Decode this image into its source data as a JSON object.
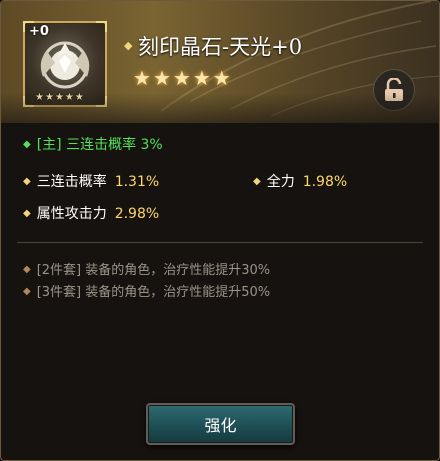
{
  "item": {
    "plus_level": "+0",
    "name": "刻印晶石-天光+0",
    "stars": 5
  },
  "main_stat": "[主] 三连击概率 3%",
  "sub_stats": [
    {
      "label": "三连击概率",
      "value": "1.31%"
    },
    {
      "label": "全力",
      "value": "1.98%"
    },
    {
      "label": "属性攻击力",
      "value": "2.98%"
    }
  ],
  "set_bonuses": [
    "[2件套] 装备的角色，治疗性能提升30%",
    "[3件套] 装备的角色，治疗性能提升50%"
  ],
  "buttons": {
    "enhance": "强化"
  },
  "icons": {
    "lock": "unlocked-padlock-icon",
    "gem": "winged-crystal-emblem-icon",
    "star": "star-icon"
  },
  "colors": {
    "main_stat": "#55e05a",
    "stat_value": "#ffd76a",
    "set_text": "#9a9387",
    "button": "#1e4f55"
  }
}
